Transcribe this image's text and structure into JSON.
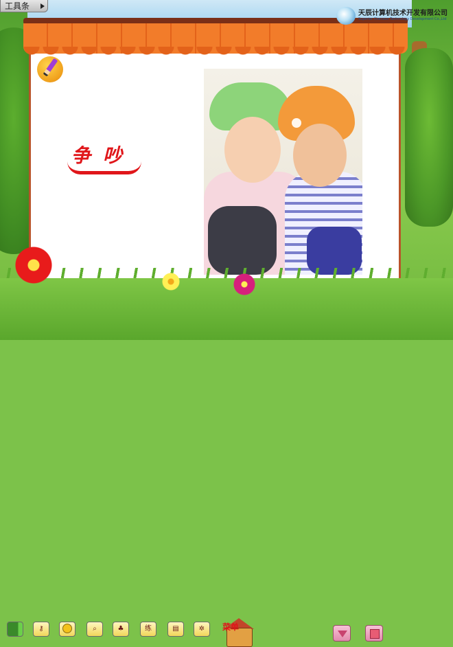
{
  "toolbar": {
    "label": "工具条"
  },
  "company": {
    "name": "天辰计算机技术开发有限公司",
    "subtitle": "Superior Chensun Technology Development Co.,Ltd"
  },
  "lesson": {
    "title": "争吵"
  },
  "bottom_tools": [
    {
      "icon": "battery-icon"
    },
    {
      "icon": "key-icon"
    },
    {
      "icon": "circle-icon"
    },
    {
      "icon": "magnifier-icon"
    },
    {
      "icon": "pine-tree-icon"
    },
    {
      "label": "练"
    },
    {
      "icon": "bar-chart-icon"
    },
    {
      "icon": "bug-icon"
    }
  ],
  "menu": {
    "label": "菜单"
  },
  "nav": {
    "next_icon": "triangle-down-icon",
    "stop_icon": "square-icon"
  }
}
